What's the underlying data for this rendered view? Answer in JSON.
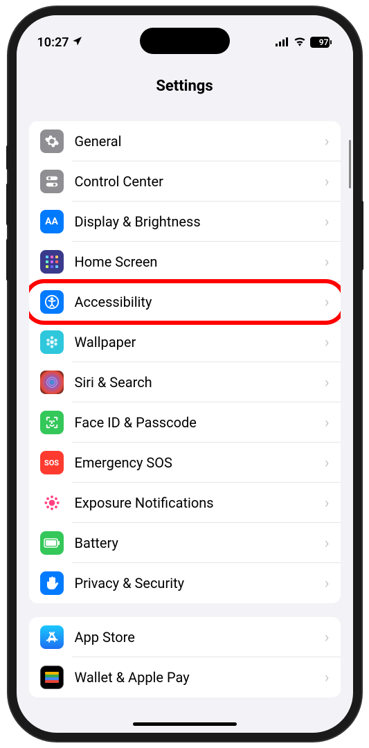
{
  "status": {
    "time": "10:27",
    "battery": "97"
  },
  "header": {
    "title": "Settings"
  },
  "sections": [
    {
      "items": [
        {
          "id": "general",
          "label": "General",
          "icon": "gear",
          "bg": "bg-gray"
        },
        {
          "id": "control-center",
          "label": "Control Center",
          "icon": "switches",
          "bg": "bg-gray"
        },
        {
          "id": "display",
          "label": "Display & Brightness",
          "icon": "aa",
          "bg": "bg-blue"
        },
        {
          "id": "home-screen",
          "label": "Home Screen",
          "icon": "grid",
          "bg": "bg-purple-grid"
        },
        {
          "id": "accessibility",
          "label": "Accessibility",
          "icon": "accessibility",
          "bg": "bg-blue",
          "highlighted": true
        },
        {
          "id": "wallpaper",
          "label": "Wallpaper",
          "icon": "flower",
          "bg": "bg-cyan"
        },
        {
          "id": "siri",
          "label": "Siri & Search",
          "icon": "siri",
          "bg": "bg-siri"
        },
        {
          "id": "faceid",
          "label": "Face ID & Passcode",
          "icon": "face",
          "bg": "bg-green"
        },
        {
          "id": "sos",
          "label": "Emergency SOS",
          "icon": "sos",
          "bg": "bg-red"
        },
        {
          "id": "exposure",
          "label": "Exposure Notifications",
          "icon": "exposure",
          "bg": "bg-white-pink"
        },
        {
          "id": "battery",
          "label": "Battery",
          "icon": "battery",
          "bg": "bg-green"
        },
        {
          "id": "privacy",
          "label": "Privacy & Security",
          "icon": "hand",
          "bg": "bg-hand-blue"
        }
      ]
    },
    {
      "items": [
        {
          "id": "appstore",
          "label": "App Store",
          "icon": "appstore",
          "bg": "bg-blue"
        },
        {
          "id": "wallet",
          "label": "Wallet & Apple Pay",
          "icon": "wallet",
          "bg": "bg-black"
        }
      ]
    }
  ]
}
